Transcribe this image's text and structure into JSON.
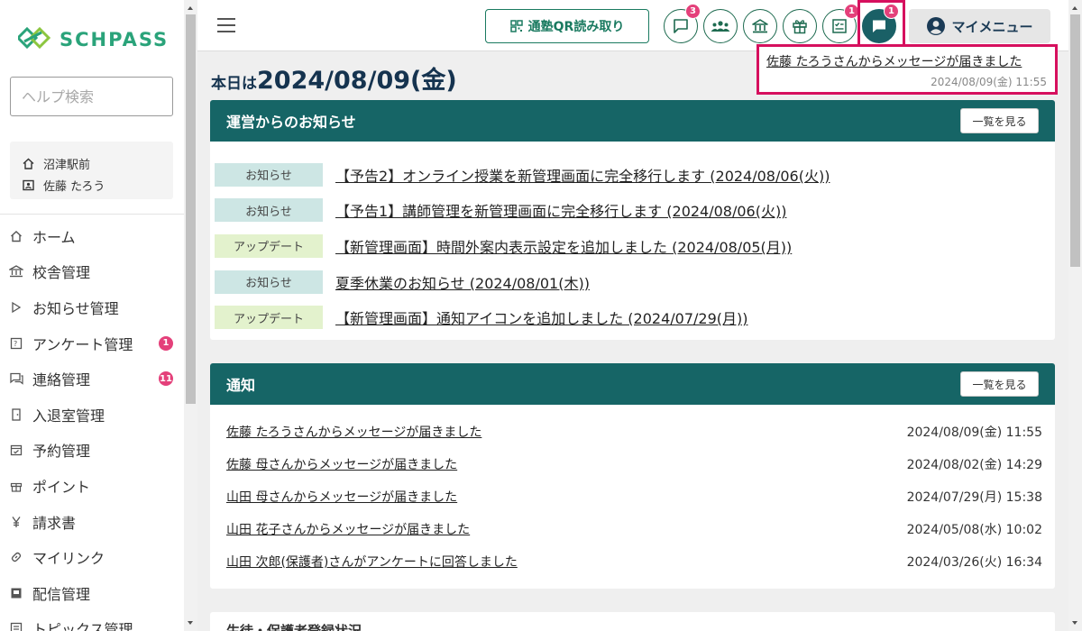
{
  "brand": {
    "name": "SCHPASS",
    "color": "#2aa37a"
  },
  "sidebar": {
    "help_search_placeholder": "ヘルプ検索",
    "school": "沼津駅前",
    "user": "佐藤 たろう",
    "items": [
      {
        "label": "ホーム",
        "icon": "home-icon",
        "badge": ""
      },
      {
        "label": "校舎管理",
        "icon": "school-icon",
        "badge": ""
      },
      {
        "label": "お知らせ管理",
        "icon": "play-icon",
        "badge": ""
      },
      {
        "label": "アンケート管理",
        "icon": "survey-icon",
        "badge": "1"
      },
      {
        "label": "連絡管理",
        "icon": "chat-icon",
        "badge": "11"
      },
      {
        "label": "入退室管理",
        "icon": "door-icon",
        "badge": ""
      },
      {
        "label": "予約管理",
        "icon": "calendar-icon",
        "badge": ""
      },
      {
        "label": "ポイント",
        "icon": "gift-icon",
        "badge": ""
      },
      {
        "label": "請求書",
        "icon": "yen-icon",
        "badge": ""
      },
      {
        "label": "マイリンク",
        "icon": "link-icon",
        "badge": ""
      },
      {
        "label": "配信管理",
        "icon": "broadcast-icon",
        "badge": ""
      },
      {
        "label": "トピックス管理",
        "icon": "topics-icon",
        "badge": ""
      }
    ]
  },
  "header": {
    "qr_label": "通塾QR読み取り",
    "icons": [
      {
        "name": "message-icon",
        "badge": "3"
      },
      {
        "name": "group-icon",
        "badge": ""
      },
      {
        "name": "school-building-icon",
        "badge": ""
      },
      {
        "name": "gift-icon",
        "badge": ""
      },
      {
        "name": "survey-icon",
        "badge": "1"
      },
      {
        "name": "notification-chat-icon",
        "badge": "1"
      }
    ],
    "mymenu_label": "マイメニュー"
  },
  "popup": {
    "message": "佐藤 たろうさんからメッセージが届きました",
    "time": "2024/08/09(金) 11:55"
  },
  "main": {
    "today_prefix": "本日は",
    "today_date": "2024/08/09(金)",
    "news": {
      "title": "運営からのお知らせ",
      "more_label": "一覧を見る",
      "items": [
        {
          "tag": "お知らせ",
          "type": "info",
          "text": "【予告2】オンライン授業を新管理画面に完全移行します (2024/08/06(火))"
        },
        {
          "tag": "お知らせ",
          "type": "info",
          "text": "【予告1】講師管理を新管理画面に完全移行します (2024/08/06(火))"
        },
        {
          "tag": "アップデート",
          "type": "update",
          "text": "【新管理画面】時間外案内表示設定を追加しました (2024/08/05(月))"
        },
        {
          "tag": "お知らせ",
          "type": "info",
          "text": "夏季休業のお知らせ (2024/08/01(木))"
        },
        {
          "tag": "アップデート",
          "type": "update",
          "text": "【新管理画面】通知アイコンを追加しました (2024/07/29(月))"
        }
      ]
    },
    "notices": {
      "title": "通知",
      "more_label": "一覧を見る",
      "items": [
        {
          "text": "佐藤 たろうさんからメッセージが届きました",
          "time": "2024/08/09(金) 11:55"
        },
        {
          "text": "佐藤 母さんからメッセージが届きました",
          "time": "2024/08/02(金) 14:29"
        },
        {
          "text": "山田 母さんからメッセージが届きました",
          "time": "2024/07/29(月) 15:38"
        },
        {
          "text": "山田 花子さんからメッセージが届きました",
          "time": "2024/05/08(水) 10:02"
        },
        {
          "text": "山田 次郎(保護者)さんがアンケートに回答しました",
          "time": "2024/03/26(火) 16:34"
        }
      ]
    },
    "third_section_title": "生徒・保護者登録状況"
  }
}
